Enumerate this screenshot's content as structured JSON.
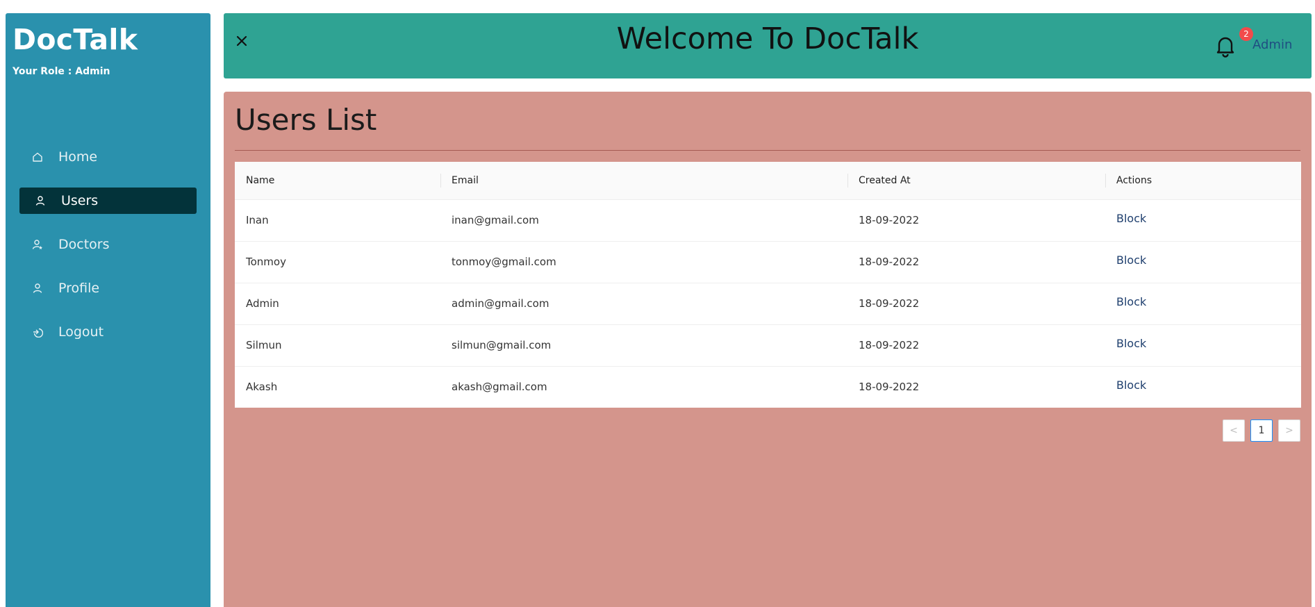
{
  "sidebar": {
    "brand": "DocTalk",
    "role": "Your Role : Admin",
    "items": [
      {
        "label": "Home",
        "icon": "home-icon"
      },
      {
        "label": "Users",
        "icon": "user-icon",
        "active": true
      },
      {
        "label": "Doctors",
        "icon": "doctor-icon"
      },
      {
        "label": "Profile",
        "icon": "user-icon"
      },
      {
        "label": "Logout",
        "icon": "logout-icon"
      }
    ]
  },
  "header": {
    "title": "Welcome To DocTalk",
    "notification_count": "2",
    "user_label": "Admin"
  },
  "main": {
    "title": "Users List",
    "table": {
      "columns": [
        "Name",
        "Email",
        "Created At",
        "Actions"
      ],
      "rows": [
        {
          "name": "Inan",
          "email": "inan@gmail.com",
          "created": "18-09-2022",
          "action": "Block"
        },
        {
          "name": "Tonmoy",
          "email": "tonmoy@gmail.com",
          "created": "18-09-2022",
          "action": "Block"
        },
        {
          "name": "Admin",
          "email": "admin@gmail.com",
          "created": "18-09-2022",
          "action": "Block"
        },
        {
          "name": "Silmun",
          "email": "silmun@gmail.com",
          "created": "18-09-2022",
          "action": "Block"
        },
        {
          "name": "Akash",
          "email": "akash@gmail.com",
          "created": "18-09-2022",
          "action": "Block"
        }
      ]
    },
    "pagination": {
      "prev": "<",
      "current": "1",
      "next": ">"
    }
  },
  "colors": {
    "sidebar": "#2a91ad",
    "sidebar_active": "#03333a",
    "header": "#2fa393",
    "main": "#d4958c",
    "badge": "#f24b4b",
    "link": "#1f3f6e"
  }
}
